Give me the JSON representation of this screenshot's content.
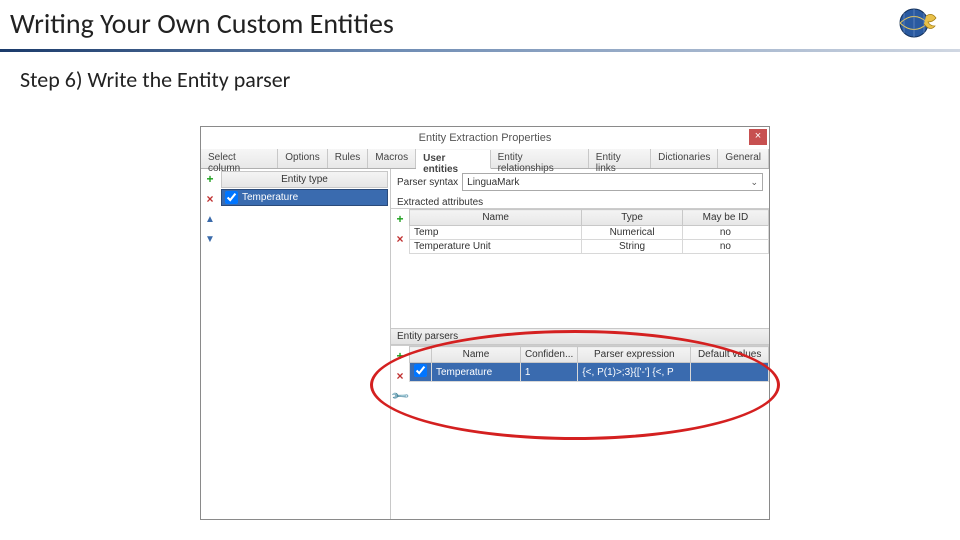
{
  "slide": {
    "title": "Writing Your Own Custom Entities",
    "subtitle": "Step 6) Write the Entity parser"
  },
  "dialog": {
    "title": "Entity Extraction Properties",
    "close": "×",
    "tabs": [
      "Select column",
      "Options",
      "Rules",
      "Macros",
      "User entities",
      "Entity relationships",
      "Entity links",
      "Dictionaries",
      "General"
    ],
    "active_tab": "User entities",
    "entity_type_header": "Entity type",
    "entity_selected": "Temperature",
    "parser_syntax_label": "Parser syntax",
    "parser_syntax_value": "LinguaMark",
    "extracted_attrs_label": "Extracted attributes",
    "attr_columns": [
      "Name",
      "Type",
      "May be ID"
    ],
    "attr_rows": [
      {
        "name": "Temp",
        "type": "Numerical",
        "id": "no"
      },
      {
        "name": "Temperature Unit",
        "type": "String",
        "id": "no"
      }
    ],
    "entity_parsers_label": "Entity parsers",
    "parser_columns": [
      "",
      "Name",
      "Confiden...",
      "Parser expression",
      "Default values"
    ],
    "parser_row": {
      "name": "Temperature",
      "conf": "1",
      "expr": "{<, P(1)>;3}{['-'] {<, P"
    }
  }
}
